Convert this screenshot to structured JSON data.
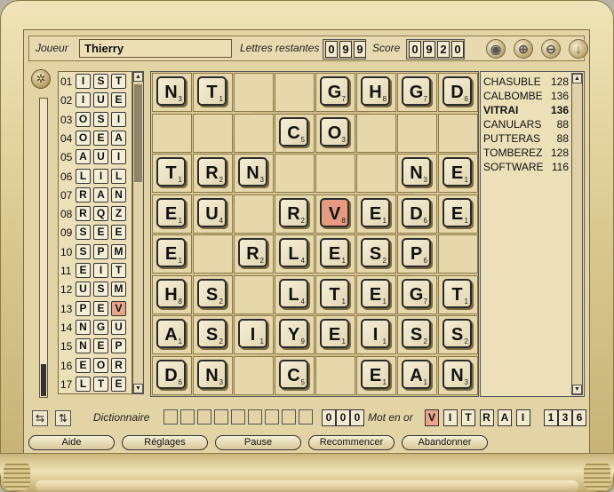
{
  "header": {
    "player_label": "Joueur",
    "player_name": "Thierry",
    "remaining_label": "Lettres restantes",
    "remaining_digits": [
      "0",
      "9",
      "9"
    ],
    "score_label": "Score",
    "score_digits": [
      "0",
      "9",
      "2",
      "0"
    ]
  },
  "toolbar_icons": [
    "speaker-icon",
    "zoom-in-icon",
    "zoom-out-icon",
    "down-arrow-icon"
  ],
  "toolbar_glyphs": [
    "◉",
    "⊕",
    "⊖",
    "↓"
  ],
  "letter_sets": [
    {
      "num": "01",
      "letters": [
        "I",
        "S",
        "T"
      ]
    },
    {
      "num": "02",
      "letters": [
        "I",
        "U",
        "E"
      ]
    },
    {
      "num": "03",
      "letters": [
        "O",
        "S",
        "I"
      ]
    },
    {
      "num": "04",
      "letters": [
        "O",
        "E",
        "A"
      ]
    },
    {
      "num": "05",
      "letters": [
        "A",
        "U",
        "I"
      ]
    },
    {
      "num": "06",
      "letters": [
        "L",
        "I",
        "L"
      ]
    },
    {
      "num": "07",
      "letters": [
        "R",
        "A",
        "N"
      ]
    },
    {
      "num": "08",
      "letters": [
        "R",
        "Q",
        "Z"
      ]
    },
    {
      "num": "09",
      "letters": [
        "S",
        "E",
        "E"
      ]
    },
    {
      "num": "10",
      "letters": [
        "S",
        "P",
        "M"
      ]
    },
    {
      "num": "11",
      "letters": [
        "E",
        "I",
        "T"
      ]
    },
    {
      "num": "12",
      "letters": [
        "U",
        "S",
        "M"
      ]
    },
    {
      "num": "13",
      "letters": [
        "P",
        "E",
        "V"
      ],
      "highlight": 2
    },
    {
      "num": "14",
      "letters": [
        "N",
        "G",
        "U"
      ]
    },
    {
      "num": "15",
      "letters": [
        "N",
        "E",
        "P"
      ]
    },
    {
      "num": "16",
      "letters": [
        "E",
        "O",
        "R"
      ]
    },
    {
      "num": "17",
      "letters": [
        "L",
        "T",
        "E"
      ]
    }
  ],
  "board": [
    [
      [
        "N",
        "3"
      ],
      [
        "T",
        "1"
      ],
      null,
      null,
      [
        "G",
        "7"
      ],
      [
        "H",
        "8"
      ],
      [
        "G",
        "7"
      ],
      [
        "D",
        "6"
      ]
    ],
    [
      null,
      null,
      null,
      [
        "C",
        "5"
      ],
      [
        "O",
        "3"
      ],
      null,
      null,
      null
    ],
    [
      [
        "T",
        "1"
      ],
      [
        "R",
        "2"
      ],
      [
        "N",
        "3"
      ],
      null,
      null,
      null,
      [
        "N",
        "3"
      ],
      [
        "E",
        "1"
      ]
    ],
    [
      [
        "E",
        "1"
      ],
      [
        "U",
        "4"
      ],
      null,
      [
        "R",
        "2"
      ],
      [
        "V",
        "8",
        "hl"
      ],
      [
        "E",
        "1"
      ],
      [
        "D",
        "6"
      ],
      [
        "E",
        "1"
      ]
    ],
    [
      [
        "E",
        "1"
      ],
      null,
      [
        "R",
        "2"
      ],
      [
        "L",
        "4"
      ],
      [
        "E",
        "1"
      ],
      [
        "S",
        "2"
      ],
      [
        "P",
        "6"
      ],
      null
    ],
    [
      [
        "H",
        "8"
      ],
      [
        "S",
        "2"
      ],
      null,
      [
        "L",
        "4"
      ],
      [
        "T",
        "1"
      ],
      [
        "E",
        "1"
      ],
      [
        "G",
        "7"
      ],
      [
        "T",
        "1"
      ]
    ],
    [
      [
        "A",
        "1"
      ],
      [
        "S",
        "2"
      ],
      [
        "I",
        "1"
      ],
      [
        "Y",
        "9"
      ],
      [
        "E",
        "1"
      ],
      [
        "I",
        "1"
      ],
      [
        "S",
        "2"
      ],
      [
        "S",
        "2"
      ]
    ],
    [
      [
        "D",
        "6"
      ],
      [
        "N",
        "3"
      ],
      null,
      [
        "C",
        "5"
      ],
      null,
      [
        "E",
        "1"
      ],
      [
        "A",
        "1"
      ],
      [
        "N",
        "3"
      ]
    ]
  ],
  "found_words": [
    {
      "word": "CHASUBLE",
      "score": "128"
    },
    {
      "word": "CALBOMBE",
      "score": "136"
    },
    {
      "word": "VITRAI",
      "score": "136",
      "bold": true
    },
    {
      "word": "CANULARS",
      "score": "88"
    },
    {
      "word": "PUTTERAS",
      "score": "88"
    },
    {
      "word": "TOMBEREZ",
      "score": "128"
    },
    {
      "word": "SOFTWARE",
      "score": "116"
    }
  ],
  "bottom": {
    "dict_label": "Dictionnaire",
    "gold_label": "Mot en or",
    "gold_count": [
      "0",
      "0",
      "0"
    ],
    "gold_word": [
      "V",
      "I",
      "T",
      "R",
      "A",
      "I"
    ],
    "gold_score": [
      "1",
      "3",
      "6"
    ]
  },
  "buttons": [
    "Aide",
    "Réglages",
    "Pause",
    "Recommencer",
    "Abandonner"
  ]
}
